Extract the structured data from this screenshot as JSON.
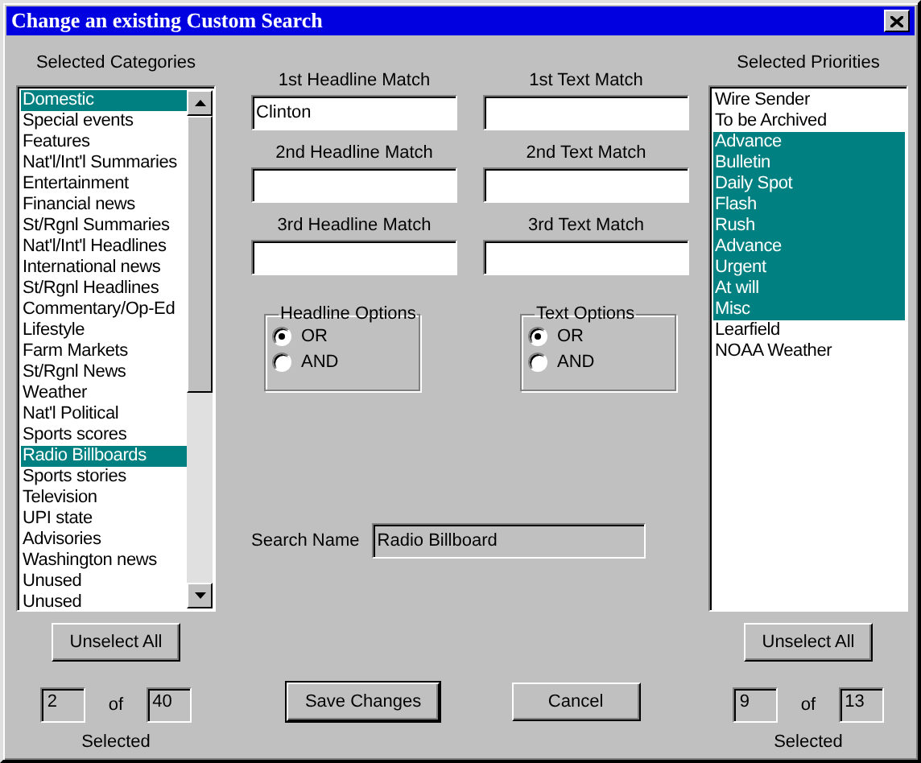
{
  "window": {
    "title": "Change an existing Custom Search"
  },
  "categories": {
    "title": "Selected Categories",
    "items": [
      {
        "label": "Domestic",
        "selected": true
      },
      {
        "label": "Special events",
        "selected": false
      },
      {
        "label": "Features",
        "selected": false
      },
      {
        "label": "Nat'l/Int'l Summaries",
        "selected": false
      },
      {
        "label": "Entertainment",
        "selected": false
      },
      {
        "label": "Financial news",
        "selected": false
      },
      {
        "label": "St/Rgnl Summaries",
        "selected": false
      },
      {
        "label": "Nat'l/Int'l Headlines",
        "selected": false
      },
      {
        "label": "International news",
        "selected": false
      },
      {
        "label": "St/Rgnl Headlines",
        "selected": false
      },
      {
        "label": "Commentary/Op-Ed",
        "selected": false
      },
      {
        "label": "Lifestyle",
        "selected": false
      },
      {
        "label": "Farm Markets",
        "selected": false
      },
      {
        "label": "St/Rgnl News",
        "selected": false
      },
      {
        "label": "Weather",
        "selected": false
      },
      {
        "label": "Nat'l Political",
        "selected": false
      },
      {
        "label": "Sports scores",
        "selected": false
      },
      {
        "label": "Radio Billboards",
        "selected": true
      },
      {
        "label": "Sports stories",
        "selected": false
      },
      {
        "label": "Television",
        "selected": false
      },
      {
        "label": "UPI state",
        "selected": false
      },
      {
        "label": "Advisories",
        "selected": false
      },
      {
        "label": "Washington news",
        "selected": false
      },
      {
        "label": "Unused",
        "selected": false
      },
      {
        "label": "Unused",
        "selected": false
      }
    ],
    "button": "Unselect All",
    "count": "2",
    "of": "of",
    "total": "40",
    "caption": "Selected"
  },
  "matches": [
    {
      "label": "1st Headline Match",
      "value": "Clinton"
    },
    {
      "label": "1st Text Match"
    },
    {
      "label": "2nd Headline Match"
    },
    {
      "label": "2nd Text Match"
    },
    {
      "label": "3rd Headline Match"
    },
    {
      "label": "3rd Text Match"
    }
  ],
  "option_groups": [
    {
      "title": "Headline Options",
      "options": [
        {
          "label": "OR",
          "selected": true
        },
        {
          "label": "AND",
          "selected": false
        }
      ]
    },
    {
      "title": "Text Options",
      "options": [
        {
          "label": "OR",
          "selected": true
        },
        {
          "label": "AND",
          "selected": false
        }
      ]
    }
  ],
  "search_name": {
    "label": "Search Name",
    "value": "Radio Billboard"
  },
  "buttons": [
    {
      "label": "Save Changes",
      "default": true
    },
    {
      "label": "Cancel",
      "default": false
    }
  ],
  "priorities": {
    "title": "Selected Priorities",
    "items": [
      {
        "label": "Wire Sender",
        "selected": false
      },
      {
        "label": "To be Archived",
        "selected": false
      },
      {
        "label": "Advance",
        "selected": true
      },
      {
        "label": "Bulletin",
        "selected": true
      },
      {
        "label": "Daily Spot",
        "selected": true
      },
      {
        "label": "Flash",
        "selected": true
      },
      {
        "label": "Rush",
        "selected": true
      },
      {
        "label": "Advance",
        "selected": true
      },
      {
        "label": "Urgent",
        "selected": true
      },
      {
        "label": "At will",
        "selected": true
      },
      {
        "label": "Misc",
        "selected": true
      },
      {
        "label": "Learfield",
        "selected": false
      },
      {
        "label": "NOAA Weather",
        "selected": false
      }
    ],
    "button": "Unselect All",
    "count": "9",
    "of": "of",
    "total": "13",
    "caption": "Selected"
  }
}
